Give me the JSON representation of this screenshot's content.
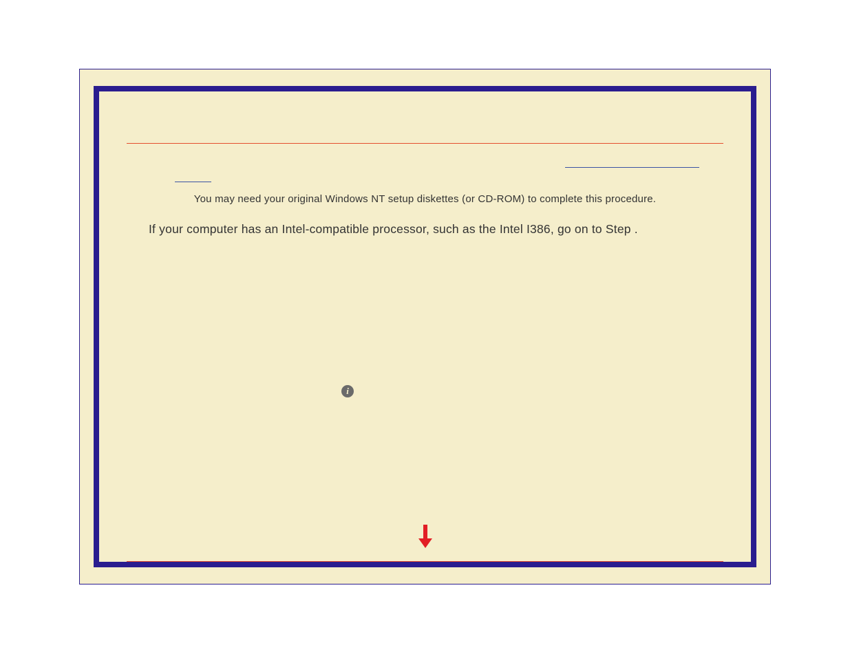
{
  "text": {
    "line1": "You may need your original Windows NT setup diskettes (or CD-ROM) to complete this procedure.",
    "line2": "If your computer has an Intel-compatible processor, such as the Intel I386, go on to Step   ."
  },
  "colors": {
    "frame": "#2a1d8f",
    "background": "#f5eecb",
    "rule": "#e44d2e",
    "link": "#3a52a3",
    "text": "#333333",
    "arrow": "#e21e25",
    "info_bg": "#6a6a6a"
  }
}
